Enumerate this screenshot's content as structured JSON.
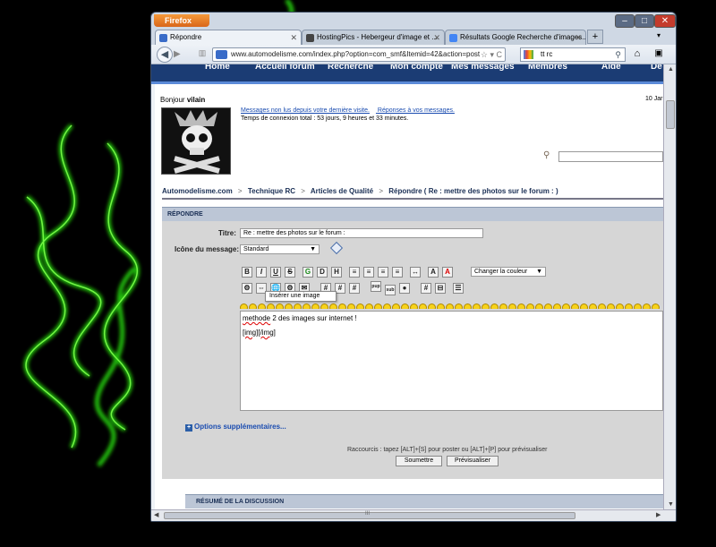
{
  "browser": {
    "app_button": "Firefox",
    "tabs": [
      {
        "label": "Répondre"
      },
      {
        "label": "HostingPics - Hebergeur d'image et ..."
      },
      {
        "label": "Résultats Google Recherche d'images..."
      }
    ],
    "url": "www.automodelisme.com/index.php?option=com_smf&Itemid=42&action=post",
    "search_value": "tt rc",
    "new_tab": "+"
  },
  "site_menu": [
    "Home",
    "Accueil forum",
    "Recherche",
    "Mon compte",
    "Mes messages",
    "Membres",
    "Aide",
    "De"
  ],
  "header": {
    "greeting": "Bonjour",
    "user": "vilain",
    "date": "10 Jar",
    "link_unread": "Messages non lus depuis votre dernière visite.",
    "link_replies": "Réponses à vos messages.",
    "connection_time": "Temps de connexion total : 53 jours, 9 heures et 33 minutes."
  },
  "breadcrumb": {
    "items": [
      "Automodelisme.com",
      "Technique RC",
      "Articles de Qualité",
      "Répondre ( Re : mettre des photos sur le forum : )"
    ],
    "sep": ">"
  },
  "form": {
    "section_title": "RÉPONDRE",
    "title_label": "Titre:",
    "title_value": "Re : mettre des photos sur le forum :",
    "icon_label": "Icône du message:",
    "icon_value": "Standard",
    "color_select": "Changer la couleur",
    "tooltip": "Insérer une image",
    "message_line1_word": "methode",
    "message_line1_rest": " 2 des images sur internet !",
    "message_line2_a": "[img]",
    "message_line2_b": "[/img]",
    "more_options": "Options supplémentaires...",
    "shortcut": "Raccourcis : tapez [ALT]+[S] pour poster ou [ALT]+[P] pour prévisualiser",
    "submit": "Soumettre",
    "preview": "Prévisualiser"
  },
  "toolbar1": [
    "B",
    "I",
    "U",
    "S",
    "G",
    "D",
    "H",
    "≡",
    "≡",
    "≡",
    "≡",
    "↔",
    "A",
    "A"
  ],
  "toolbar2": [
    "⚙",
    "⇔",
    "🌐",
    "⚙",
    "✉",
    "#",
    "#",
    "#",
    "pup",
    "sub",
    "●",
    "#",
    "⊟",
    "☰"
  ],
  "summary_title": "RÉSUMÉ DE LA DISCUSSION",
  "scroll": {
    "h_thumb_label": "III"
  }
}
